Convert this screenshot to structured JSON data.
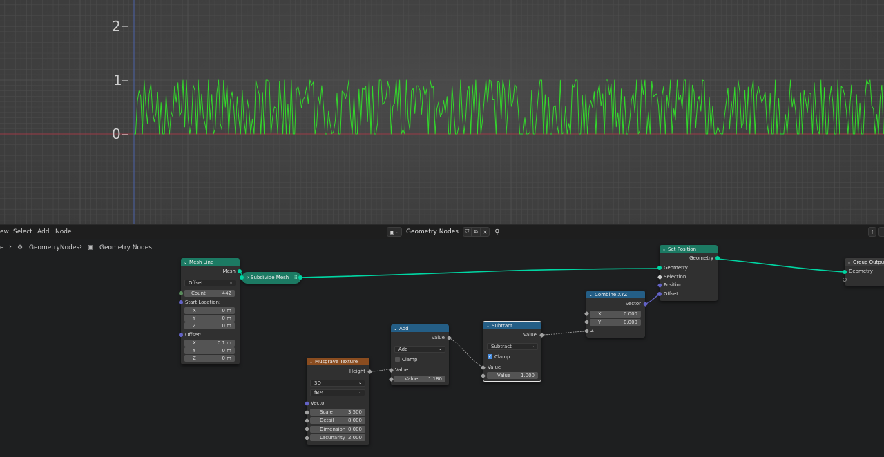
{
  "viewport": {
    "y_labels": [
      "2",
      "1",
      "0"
    ]
  },
  "header": {
    "menus": [
      "ew",
      "Select",
      "Add",
      "Node"
    ],
    "tree_name": "Geometry Nodes",
    "btn_icons": [
      "shield-icon",
      "duplicate-icon",
      "close-icon",
      "pin-icon"
    ]
  },
  "breadcrumb": {
    "items": [
      "e",
      "GeometryNodes",
      "Geometry Nodes"
    ]
  },
  "nodes": {
    "mesh_line": {
      "title": "Mesh Line",
      "out_mesh": "Mesh",
      "mode": "Offset",
      "count_label": "Count",
      "count_value": "442",
      "start_label": "Start Location:",
      "start": [
        {
          "k": "X",
          "v": "0 m"
        },
        {
          "k": "Y",
          "v": "0 m"
        },
        {
          "k": "Z",
          "v": "0 m"
        }
      ],
      "offset_label": "Offset:",
      "offset": [
        {
          "k": "X",
          "v": "0.1 m"
        },
        {
          "k": "Y",
          "v": "0 m"
        },
        {
          "k": "Z",
          "v": "0 m"
        }
      ]
    },
    "subdivide": {
      "title": "Subdivide Mesh"
    },
    "set_position": {
      "title": "Set Position",
      "out": "Geometry",
      "inputs": [
        "Geometry",
        "Selection",
        "Position",
        "Offset"
      ]
    },
    "group_output": {
      "title": "Group Output",
      "input": "Geometry"
    },
    "combine_xyz": {
      "title": "Combine XYZ",
      "out": "Vector",
      "x_label": "X",
      "x_value": "0.000",
      "y_label": "Y",
      "y_value": "0.000",
      "z_label": "Z"
    },
    "add": {
      "title": "Add",
      "out": "Value",
      "op": "Add",
      "clamp": "Clamp",
      "in_value": "Value",
      "value_label": "Value",
      "value": "1.180"
    },
    "subtract": {
      "title": "Subtract",
      "out": "Value",
      "op": "Subtract",
      "clamp": "Clamp",
      "in_value": "Value",
      "value_label": "Value",
      "value": "1.000"
    },
    "musgrave": {
      "title": "Musgrave Texture",
      "out": "Height",
      "dim": "3D",
      "type": "fBM",
      "vector": "Vector",
      "fields": [
        {
          "k": "Scale",
          "v": "3.500"
        },
        {
          "k": "Detail",
          "v": "8.000"
        },
        {
          "k": "Dimension",
          "v": "0.000"
        },
        {
          "k": "Lacunarity",
          "v": "2.000"
        }
      ]
    }
  },
  "colors": {
    "geometry_socket": "#00d6a3",
    "vector_socket": "#6363c7",
    "float_socket": "#a1a1a1",
    "plot_line": "#33d92b"
  }
}
